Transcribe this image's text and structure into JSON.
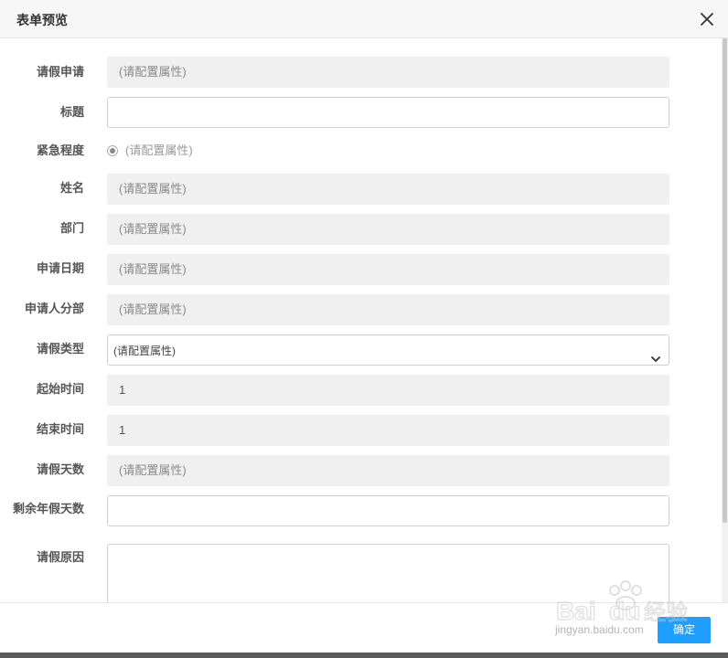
{
  "dialog": {
    "title": "表单预览",
    "close_icon": "close-icon"
  },
  "form": {
    "rows": [
      {
        "label": "请假申请",
        "type": "readonly",
        "value": "(请配置属性)"
      },
      {
        "label": "标题",
        "type": "input",
        "value": ""
      },
      {
        "label": "紧急程度",
        "type": "radio",
        "value": "(请配置属性)"
      },
      {
        "label": "姓名",
        "type": "readonly",
        "value": "(请配置属性)"
      },
      {
        "label": "部门",
        "type": "readonly",
        "value": "(请配置属性)"
      },
      {
        "label": "申请日期",
        "type": "readonly",
        "value": "(请配置属性)"
      },
      {
        "label": "申请人分部",
        "type": "readonly",
        "value": "(请配置属性)"
      },
      {
        "label": "请假类型",
        "type": "select",
        "value": "(请配置属性)"
      },
      {
        "label": "起始时间",
        "type": "readonly",
        "value": "1"
      },
      {
        "label": "结束时间",
        "type": "readonly",
        "value": "1"
      },
      {
        "label": "请假天数",
        "type": "readonly",
        "value": "(请配置属性)"
      },
      {
        "label": "剩余年假天数",
        "type": "input",
        "value": ""
      },
      {
        "label": "请假原因",
        "type": "textarea",
        "value": ""
      }
    ]
  },
  "footer": {
    "ok_label": "确定"
  },
  "watermark": {
    "brand": "Baidu经验",
    "url": "jingyan.baidu.com"
  },
  "colors": {
    "accent": "#1e9fff",
    "readonly_bg": "#f0f0f0",
    "header_bg": "#f7f7f7"
  }
}
